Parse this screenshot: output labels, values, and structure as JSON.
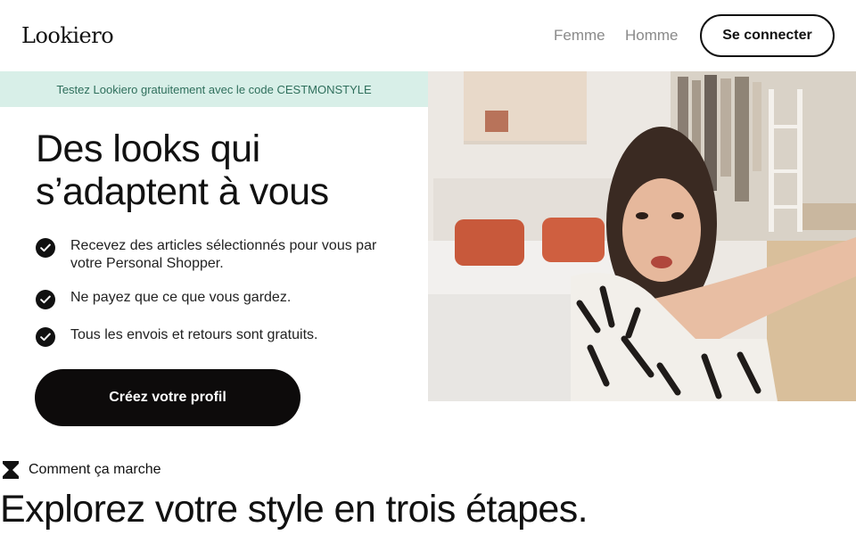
{
  "header": {
    "logo": "Lookiero",
    "nav": [
      {
        "label": "Femme"
      },
      {
        "label": "Homme"
      }
    ],
    "login_label": "Se connecter"
  },
  "promo": {
    "text": "Testez Lookiero gratuitement avec le code CESTMONSTYLE"
  },
  "hero": {
    "title": "Des looks qui s’adaptent à vous",
    "benefits": [
      {
        "text": "Recevez des articles sélectionnés pour vous par votre Personal Shopper.",
        "icon": "check-icon"
      },
      {
        "text": "Ne payez que ce que vous gardez.",
        "icon": "check-icon"
      },
      {
        "text": "Tous les envois et retours sont gratuits.",
        "icon": "check-icon"
      }
    ],
    "cta_label": "Créez votre profil"
  },
  "how_it_works": {
    "label": "Comment ça marche",
    "icon": "hourglass-icon",
    "title": "Explorez votre style en trois étapes."
  },
  "colors": {
    "promo_bg": "#d8efe8",
    "promo_text": "#2f6f5c",
    "cta_bg": "#0d0b0b",
    "nav_text": "#8a8a8a",
    "text": "#111111"
  }
}
